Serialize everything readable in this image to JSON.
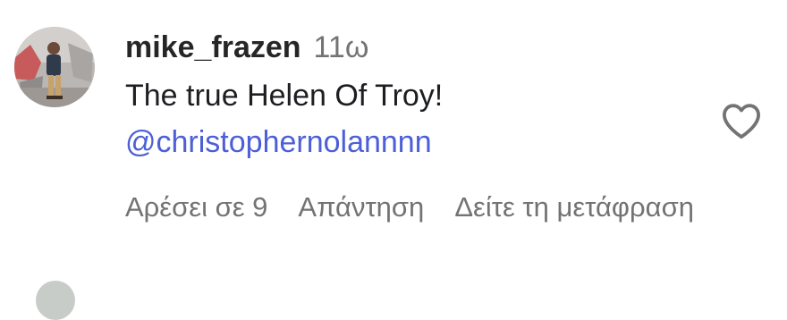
{
  "comment": {
    "username": "mike_frazen",
    "timestamp": "11ω",
    "text": "The true Helen Of Troy!",
    "mention": "@christophernolannnn",
    "actions": {
      "likes": "Αρέσει σε 9",
      "reply": "Απάντηση",
      "translate": "Δείτε τη μετάφραση"
    }
  },
  "colors": {
    "username": "#262626",
    "secondary_text": "#737373",
    "mention_link": "#4c5fd7"
  },
  "icons": {
    "like": "heart-outline-icon"
  }
}
